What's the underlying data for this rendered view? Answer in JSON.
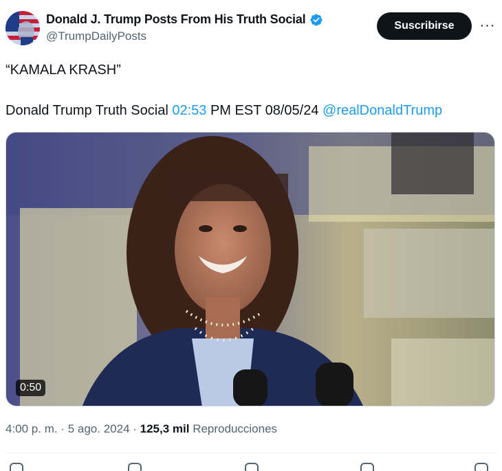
{
  "author": {
    "name": "Donald J. Trump Posts From His Truth Social",
    "handle": "@TrumpDailyPosts",
    "verified": true
  },
  "subscribe_label": "Suscribirse",
  "more_label": "···",
  "post": {
    "line1": "“KAMALA KRASH”",
    "line2_prefix": "Donald Trump Truth Social ",
    "line2_time": "02:53",
    "line2_middle": " PM EST 08/05/24 ",
    "line2_mention": "@realDonaldTrump"
  },
  "media": {
    "duration": "0:50"
  },
  "meta": {
    "time": "4:00 p. m.",
    "sep1": " · ",
    "date": "5 ago. 2024",
    "sep2": " · ",
    "views": "125,3 mil",
    "views_label": " Reproducciones"
  },
  "colors": {
    "accent": "#1d9bf0",
    "text": "#0f1419",
    "muted": "#536471"
  }
}
